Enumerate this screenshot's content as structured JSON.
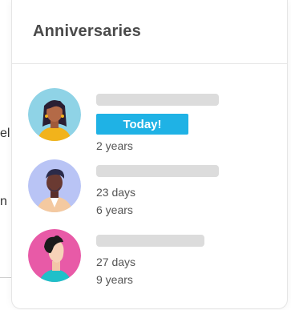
{
  "background": {
    "fragments": [
      "el",
      "n"
    ]
  },
  "card": {
    "title": "Anniversaries"
  },
  "items": [
    {
      "badge": "Today!",
      "duration": "2 years",
      "avatar_color": "#8fd3e6",
      "avatar_icon": "woman-avatar-icon"
    },
    {
      "days": "23 days",
      "duration": "6 years",
      "avatar_color": "#b9c4f5",
      "avatar_icon": "man-avatar-icon"
    },
    {
      "days": "27 days",
      "duration": "9 years",
      "avatar_color": "#e85aa7",
      "avatar_icon": "person-avatar-icon"
    }
  ],
  "colors": {
    "badge": "#1fb2e5",
    "skeleton": "#dcdcdc",
    "title": "#4a4a4a",
    "text": "#555555"
  }
}
